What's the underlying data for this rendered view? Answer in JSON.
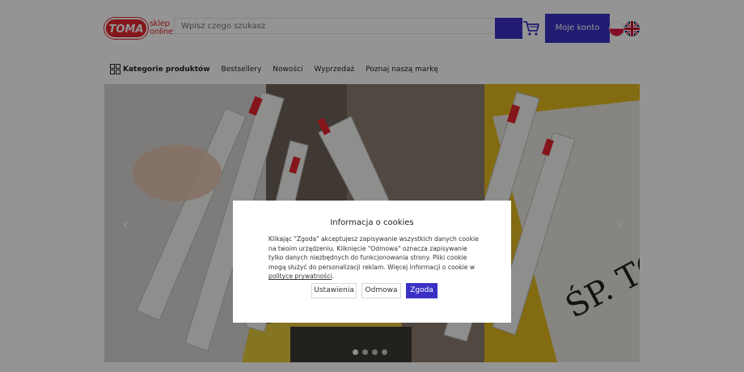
{
  "header": {
    "logo_brand": "TOMA",
    "logo_tagline_1": "sklep",
    "logo_tagline_2": "online",
    "search_placeholder": "Wpisz czego szukasz",
    "account_label": "Moje konto",
    "accent_color": "#3a31c4",
    "brand_color": "#e3262f"
  },
  "nav": {
    "items": [
      "Kategorie produktów",
      "Bestsellery",
      "Nowości",
      "Wyprzedaż",
      "Poznaj naszą markę"
    ]
  },
  "carousel": {
    "slide_count": 4,
    "active_index": 0
  },
  "cookie_modal": {
    "title": "Informacja o cookies",
    "body": "Klikając \"Zgoda\" akceptujesz zapisywanie wszystkich danych cookie na twoim urządzeniu. Kliknięcie \"Odmowa\" oznacza zapisywanie tylko danych niezbędnych do funkcjonowania strony. Pliki cookie mogą służyć do personalizacji reklam. Więcej informacji o cookie w ",
    "link_text": "polityce prywatności",
    "body_end": ".",
    "buttons": {
      "settings": "Ustawienia",
      "reject": "Odmowa",
      "accept": "Zgoda"
    }
  }
}
